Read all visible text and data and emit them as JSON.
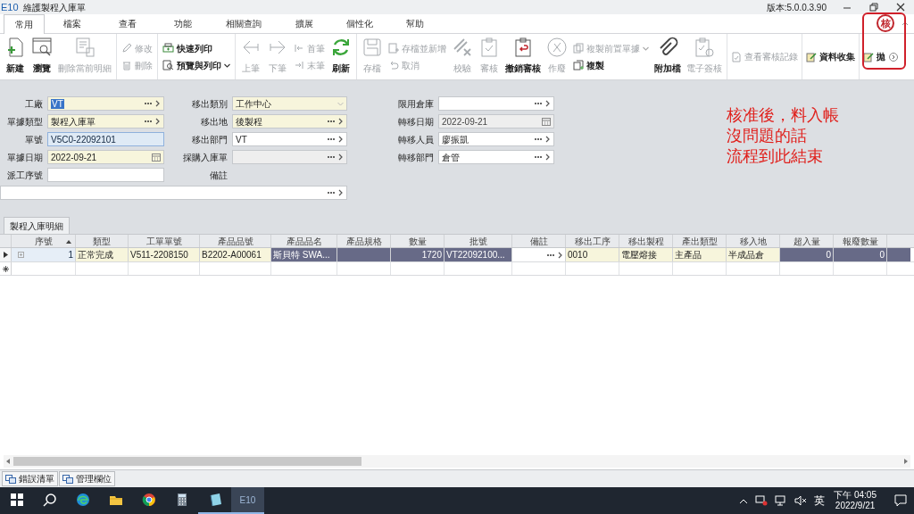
{
  "window": {
    "logo": "E10",
    "title": "維護製程入庫單",
    "version": "版本:5.0.0.3.90"
  },
  "tabs": [
    {
      "label": "常用",
      "selected": true
    },
    {
      "label": "檔案",
      "selected": false
    },
    {
      "label": "查看",
      "selected": false
    },
    {
      "label": "功能",
      "selected": false
    },
    {
      "label": "相關查詢",
      "selected": false
    },
    {
      "label": "擴展",
      "selected": false
    },
    {
      "label": "個性化",
      "selected": false
    },
    {
      "label": "幫助",
      "selected": false
    }
  ],
  "status_stamp": "核",
  "toolbar": {
    "groups": [
      {
        "items": [
          {
            "kind": "large",
            "label": "新建",
            "disabled": false
          },
          {
            "kind": "large",
            "label": "瀏覽",
            "disabled": false
          },
          {
            "kind": "large",
            "label": "刪除當前明細",
            "disabled": true
          }
        ]
      },
      {
        "items": [
          {
            "kind": "pair",
            "items": [
              {
                "label": "修改",
                "disabled": true,
                "dropdown": false
              },
              {
                "label": "刪除",
                "disabled": true,
                "dropdown": false
              }
            ]
          }
        ]
      },
      {
        "items": [
          {
            "kind": "pair",
            "items": [
              {
                "label": "快速列印",
                "disabled": false,
                "dropdown": false
              },
              {
                "label": "預覽與列印",
                "disabled": false,
                "dropdown": true
              }
            ]
          }
        ]
      },
      {
        "items": [
          {
            "kind": "large",
            "label": "上筆",
            "disabled": true
          },
          {
            "kind": "large",
            "label": "下筆",
            "disabled": true
          },
          {
            "kind": "pair",
            "items": [
              {
                "label": "首筆",
                "disabled": true,
                "dropdown": false
              },
              {
                "label": "末筆",
                "disabled": true,
                "dropdown": false
              }
            ]
          },
          {
            "kind": "large",
            "label": "刷新",
            "disabled": false
          }
        ]
      },
      {
        "items": [
          {
            "kind": "large",
            "label": "存檔",
            "disabled": true
          },
          {
            "kind": "pair",
            "items": [
              {
                "label": "存檔並新增",
                "disabled": true,
                "dropdown": false
              },
              {
                "label": "取消",
                "disabled": true,
                "dropdown": false
              }
            ]
          },
          {
            "kind": "large",
            "label": "校驗",
            "disabled": true
          },
          {
            "kind": "large",
            "label": "審核",
            "disabled": true
          },
          {
            "kind": "large",
            "label": "撤銷審核",
            "disabled": false
          },
          {
            "kind": "large",
            "label": "作廢",
            "disabled": true
          },
          {
            "kind": "pair",
            "items": [
              {
                "label": "複製前置單據",
                "disabled": true,
                "dropdown": true
              },
              {
                "label": "複製",
                "disabled": false,
                "dropdown": false
              }
            ]
          },
          {
            "kind": "large",
            "label": "附加檔",
            "disabled": false
          },
          {
            "kind": "large",
            "label": "電子簽核",
            "disabled": true
          }
        ]
      },
      {
        "items": [
          {
            "kind": "small",
            "label": "查看審核記錄",
            "disabled": true
          }
        ]
      },
      {
        "items": [
          {
            "kind": "small",
            "label": "資料收集",
            "disabled": false
          }
        ]
      },
      {
        "items": [
          {
            "kind": "small",
            "label": "拋",
            "disabled": false
          }
        ]
      }
    ]
  },
  "form": {
    "rows": [
      [
        {
          "label": "工廠",
          "value": "VT",
          "kind": "lookup",
          "required": true,
          "readonly": false,
          "focused": false,
          "text_selected": true
        },
        {
          "label": "移出類別",
          "value": "工作中心",
          "kind": "select",
          "required": true,
          "readonly": false,
          "focused": false,
          "text_selected": false
        },
        {
          "label": "限用倉庫",
          "kind": "lookup",
          "required": false,
          "readonly": false,
          "focused": false
        }
      ],
      [
        {
          "label": "單據類型",
          "value": "製程入庫單",
          "kind": "lookup",
          "required": true,
          "readonly": false,
          "focused": false,
          "text_selected": false
        },
        {
          "label": "移出地",
          "value": "後製程",
          "kind": "lookup",
          "required": true,
          "readonly": false,
          "focused": false,
          "text_selected": false
        },
        {
          "label": "轉移日期",
          "value": "2022-09-21",
          "kind": "date",
          "required": false,
          "readonly": true,
          "focused": false,
          "text_selected": false
        }
      ],
      [
        {
          "label": "單號",
          "value": "V5C0-22092101",
          "kind": "text",
          "required": false,
          "readonly": false,
          "focused": true,
          "text_selected": false
        },
        {
          "label": "移出部門",
          "value": "VT",
          "kind": "lookup",
          "required": false,
          "readonly": false,
          "focused": false,
          "text_selected": false
        },
        {
          "label": "轉移人員",
          "value": "廖振凱",
          "kind": "lookup",
          "required": false,
          "readonly": false,
          "focused": false,
          "text_selected": false
        }
      ],
      [
        {
          "label": "單據日期",
          "value": "2022-09-21",
          "kind": "date",
          "required": true,
          "readonly": false,
          "focused": false,
          "text_selected": false
        },
        {
          "label": "採購入庫單",
          "kind": "lookup",
          "required": false,
          "readonly": true,
          "focused": false
        },
        {
          "label": "轉移部門",
          "value": "倉管",
          "kind": "lookup",
          "required": false,
          "readonly": false,
          "focused": false,
          "text_selected": false
        }
      ],
      [
        {
          "label": "派工序號",
          "kind": "text",
          "required": false,
          "readonly": false,
          "focused": false
        },
        {
          "label": "備註",
          "kind": "lookup",
          "required": false,
          "readonly": false,
          "focused": false
        }
      ]
    ]
  },
  "annotation": {
    "lines": [
      "核准後，料入帳",
      "沒問題的話",
      "流程到此結束"
    ]
  },
  "detail_tab": "製程入庫明細",
  "table": {
    "columns": [
      {
        "label": "序號",
        "sorted": true
      },
      {
        "label": "類型",
        "sorted": false
      },
      {
        "label": "工單單號",
        "sorted": false
      },
      {
        "label": "產品品號",
        "sorted": false
      },
      {
        "label": "產品品名",
        "sorted": false
      },
      {
        "label": "產品規格",
        "sorted": false
      },
      {
        "label": "數量",
        "sorted": false
      },
      {
        "label": "批號",
        "sorted": false
      },
      {
        "label": "備註",
        "sorted": false
      },
      {
        "label": "移出工序",
        "sorted": false
      },
      {
        "label": "移出製程",
        "sorted": false
      },
      {
        "label": "產出類型",
        "sorted": false
      },
      {
        "label": "移入地",
        "sorted": false
      },
      {
        "label": "超入量",
        "sorted": false
      },
      {
        "label": "報廢數量",
        "sorted": false
      }
    ],
    "rows": [
      {
        "selected": true,
        "cells": [
          {
            "text": "1",
            "kind": "expand",
            "required": false,
            "readonly": false,
            "focused": true
          },
          {
            "text": "正常完成",
            "kind": "text",
            "required": true,
            "readonly": false,
            "focused": false
          },
          {
            "text": "V511-2208150",
            "kind": "text",
            "required": true,
            "readonly": false,
            "focused": false
          },
          {
            "text": "B2202-A00061",
            "kind": "text",
            "required": true,
            "readonly": false,
            "focused": false
          },
          {
            "text": "斯貝特 SWA...",
            "kind": "text",
            "required": false,
            "readonly": true,
            "focused": false
          },
          {
            "kind": "text",
            "required": false,
            "readonly": true,
            "focused": false
          },
          {
            "text": "1720",
            "kind": "number",
            "required": false,
            "readonly": true,
            "focused": false
          },
          {
            "text": "VT22092100...",
            "kind": "text",
            "required": false,
            "readonly": true,
            "focused": false
          },
          {
            "kind": "lookup",
            "required": false,
            "readonly": false,
            "focused": false
          },
          {
            "text": "0010",
            "kind": "text",
            "required": true,
            "readonly": false,
            "focused": false
          },
          {
            "text": "電壓熔接",
            "kind": "text",
            "required": true,
            "readonly": false,
            "focused": false
          },
          {
            "text": "主產品",
            "kind": "text",
            "required": true,
            "readonly": false,
            "focused": false
          },
          {
            "text": "半成品倉",
            "kind": "text",
            "required": true,
            "readonly": false,
            "focused": false
          },
          {
            "text": "0",
            "kind": "number",
            "required": false,
            "readonly": true,
            "focused": false
          },
          {
            "text": "0",
            "kind": "number",
            "required": false,
            "readonly": true,
            "focused": false
          }
        ]
      }
    ]
  },
  "bottom_tabs": [
    "錯誤清單",
    "管理欄位"
  ],
  "taskbar": {
    "apps": [
      {
        "running": false,
        "selected": false
      },
      {
        "running": false,
        "selected": false
      },
      {
        "running": false,
        "selected": false
      },
      {
        "running": false,
        "selected": false
      },
      {
        "running": false,
        "selected": false
      },
      {
        "running": false,
        "selected": false
      },
      {
        "running": true,
        "selected": false
      },
      {
        "label": "E10",
        "running": true,
        "selected": true
      }
    ],
    "input_method": "英",
    "time": "下午 04:05",
    "date": "2022/9/21"
  }
}
